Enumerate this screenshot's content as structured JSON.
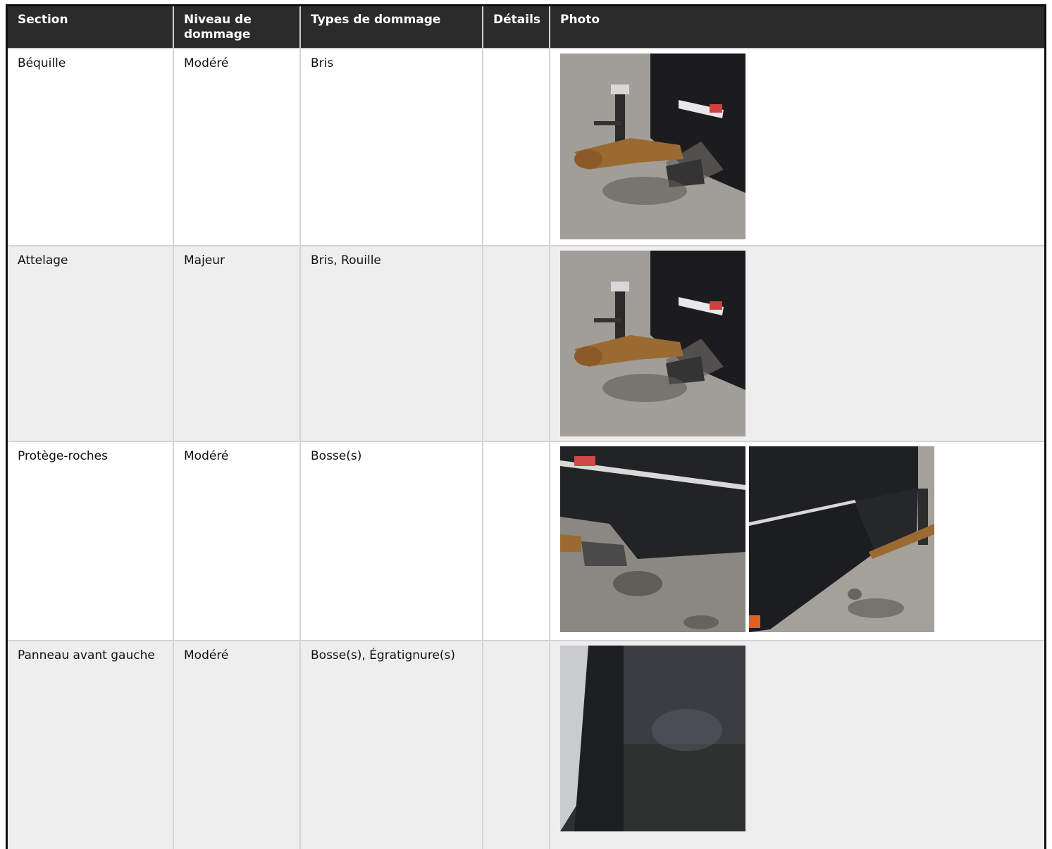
{
  "headers": [
    "Section",
    "Niveau de dommage",
    "Types de dommage",
    "Détails",
    "Photo"
  ],
  "rows": [
    {
      "section": "Béquille",
      "niveau": "Modéré",
      "types": "Bris",
      "details": "",
      "photos": [
        "trailer-jack-hitch-photo"
      ]
    },
    {
      "section": "Attelage",
      "niveau": "Majeur",
      "types": "Bris, Rouille",
      "details": "",
      "photos": [
        "trailer-jack-hitch-photo"
      ]
    },
    {
      "section": "Protège-roches",
      "niveau": "Modéré",
      "types": "Bosse(s)",
      "details": "",
      "photos": [
        "rock-guard-photo-1",
        "rock-guard-photo-2"
      ]
    },
    {
      "section": "Panneau avant gauche",
      "niveau": "Modéré",
      "types": "Bosse(s), Égratignure(s)",
      "details": "",
      "photos": [
        "front-left-panel-photo"
      ]
    }
  ]
}
